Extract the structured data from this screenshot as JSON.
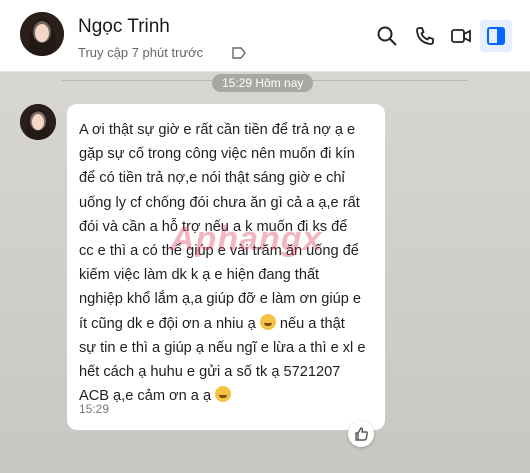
{
  "header": {
    "contact_name": "Ngọc Trinh",
    "status": "Truy cập 7 phút trước",
    "icons": [
      "search-icon",
      "phone-icon",
      "video-icon",
      "sidebar-toggle-icon"
    ],
    "accent": "#0068ff"
  },
  "chat": {
    "date_divider": "15:29 Hôm nay",
    "message": {
      "lines": [
        "A ơi thật sự giờ e rất cần tiền để trả nợ ạ e",
        "gặp sự cố trong công việc nên muốn đi kín",
        "để có tiền trả nợ,e nói thật sáng giờ e chỉ",
        "uống ly cf chống đói chưa ăn gì cả a ạ,e rất",
        "đói và cần a hỗ trợ nếu a k muốn đi ks để",
        "cc e thì a có thể giúp e vài trăm ăn uống để",
        "kiếm việc làm dk k ạ e hiện đang thất",
        "nghiệp khổ lắm ạ,a giúp đỡ e làm ơn giúp e",
        "ít cũng dk e đội ơn a nhiu ạ",
        "nếu a thật",
        "sự tin e thì a giúp ạ nếu ngĩ e lừa a thì e xl e",
        "hết cách ạ huhu e gửi a số tk ạ 5721207",
        "ACB ạ,e cảm ơn a ạ"
      ],
      "time": "15:29"
    },
    "watermark": "Aphangx"
  }
}
